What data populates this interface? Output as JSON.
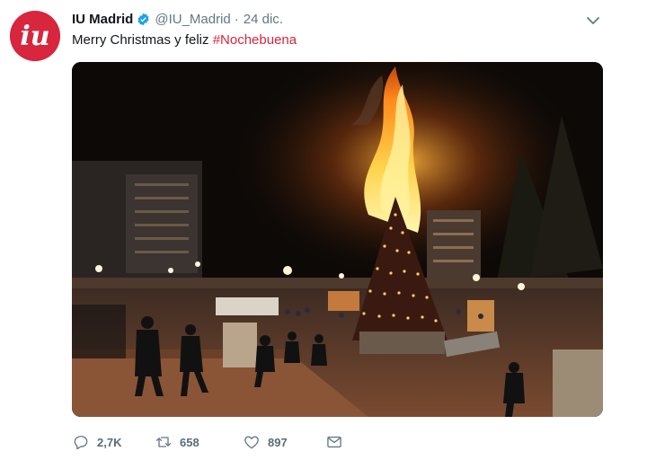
{
  "tweet": {
    "author_name": "IU Madrid",
    "handle": "@IU_Madrid",
    "separator": "·",
    "date": "24 dic.",
    "text_prefix": "Merry Christmas y feliz ",
    "hashtag": "#Nochebuena",
    "avatar_text": "iu"
  },
  "icons": {
    "avatar": "iu-logo",
    "verified": "verified-badge-icon",
    "caret": "chevron-down-icon",
    "reply": "reply-icon",
    "retweet": "retweet-icon",
    "like": "heart-icon",
    "message": "direct-message-icon"
  },
  "actions": {
    "replies": "2,7K",
    "retweets": "658",
    "likes": "897"
  },
  "colors": {
    "brand": "#d7263d",
    "verified": "#1da1f2",
    "muted": "#657786"
  }
}
